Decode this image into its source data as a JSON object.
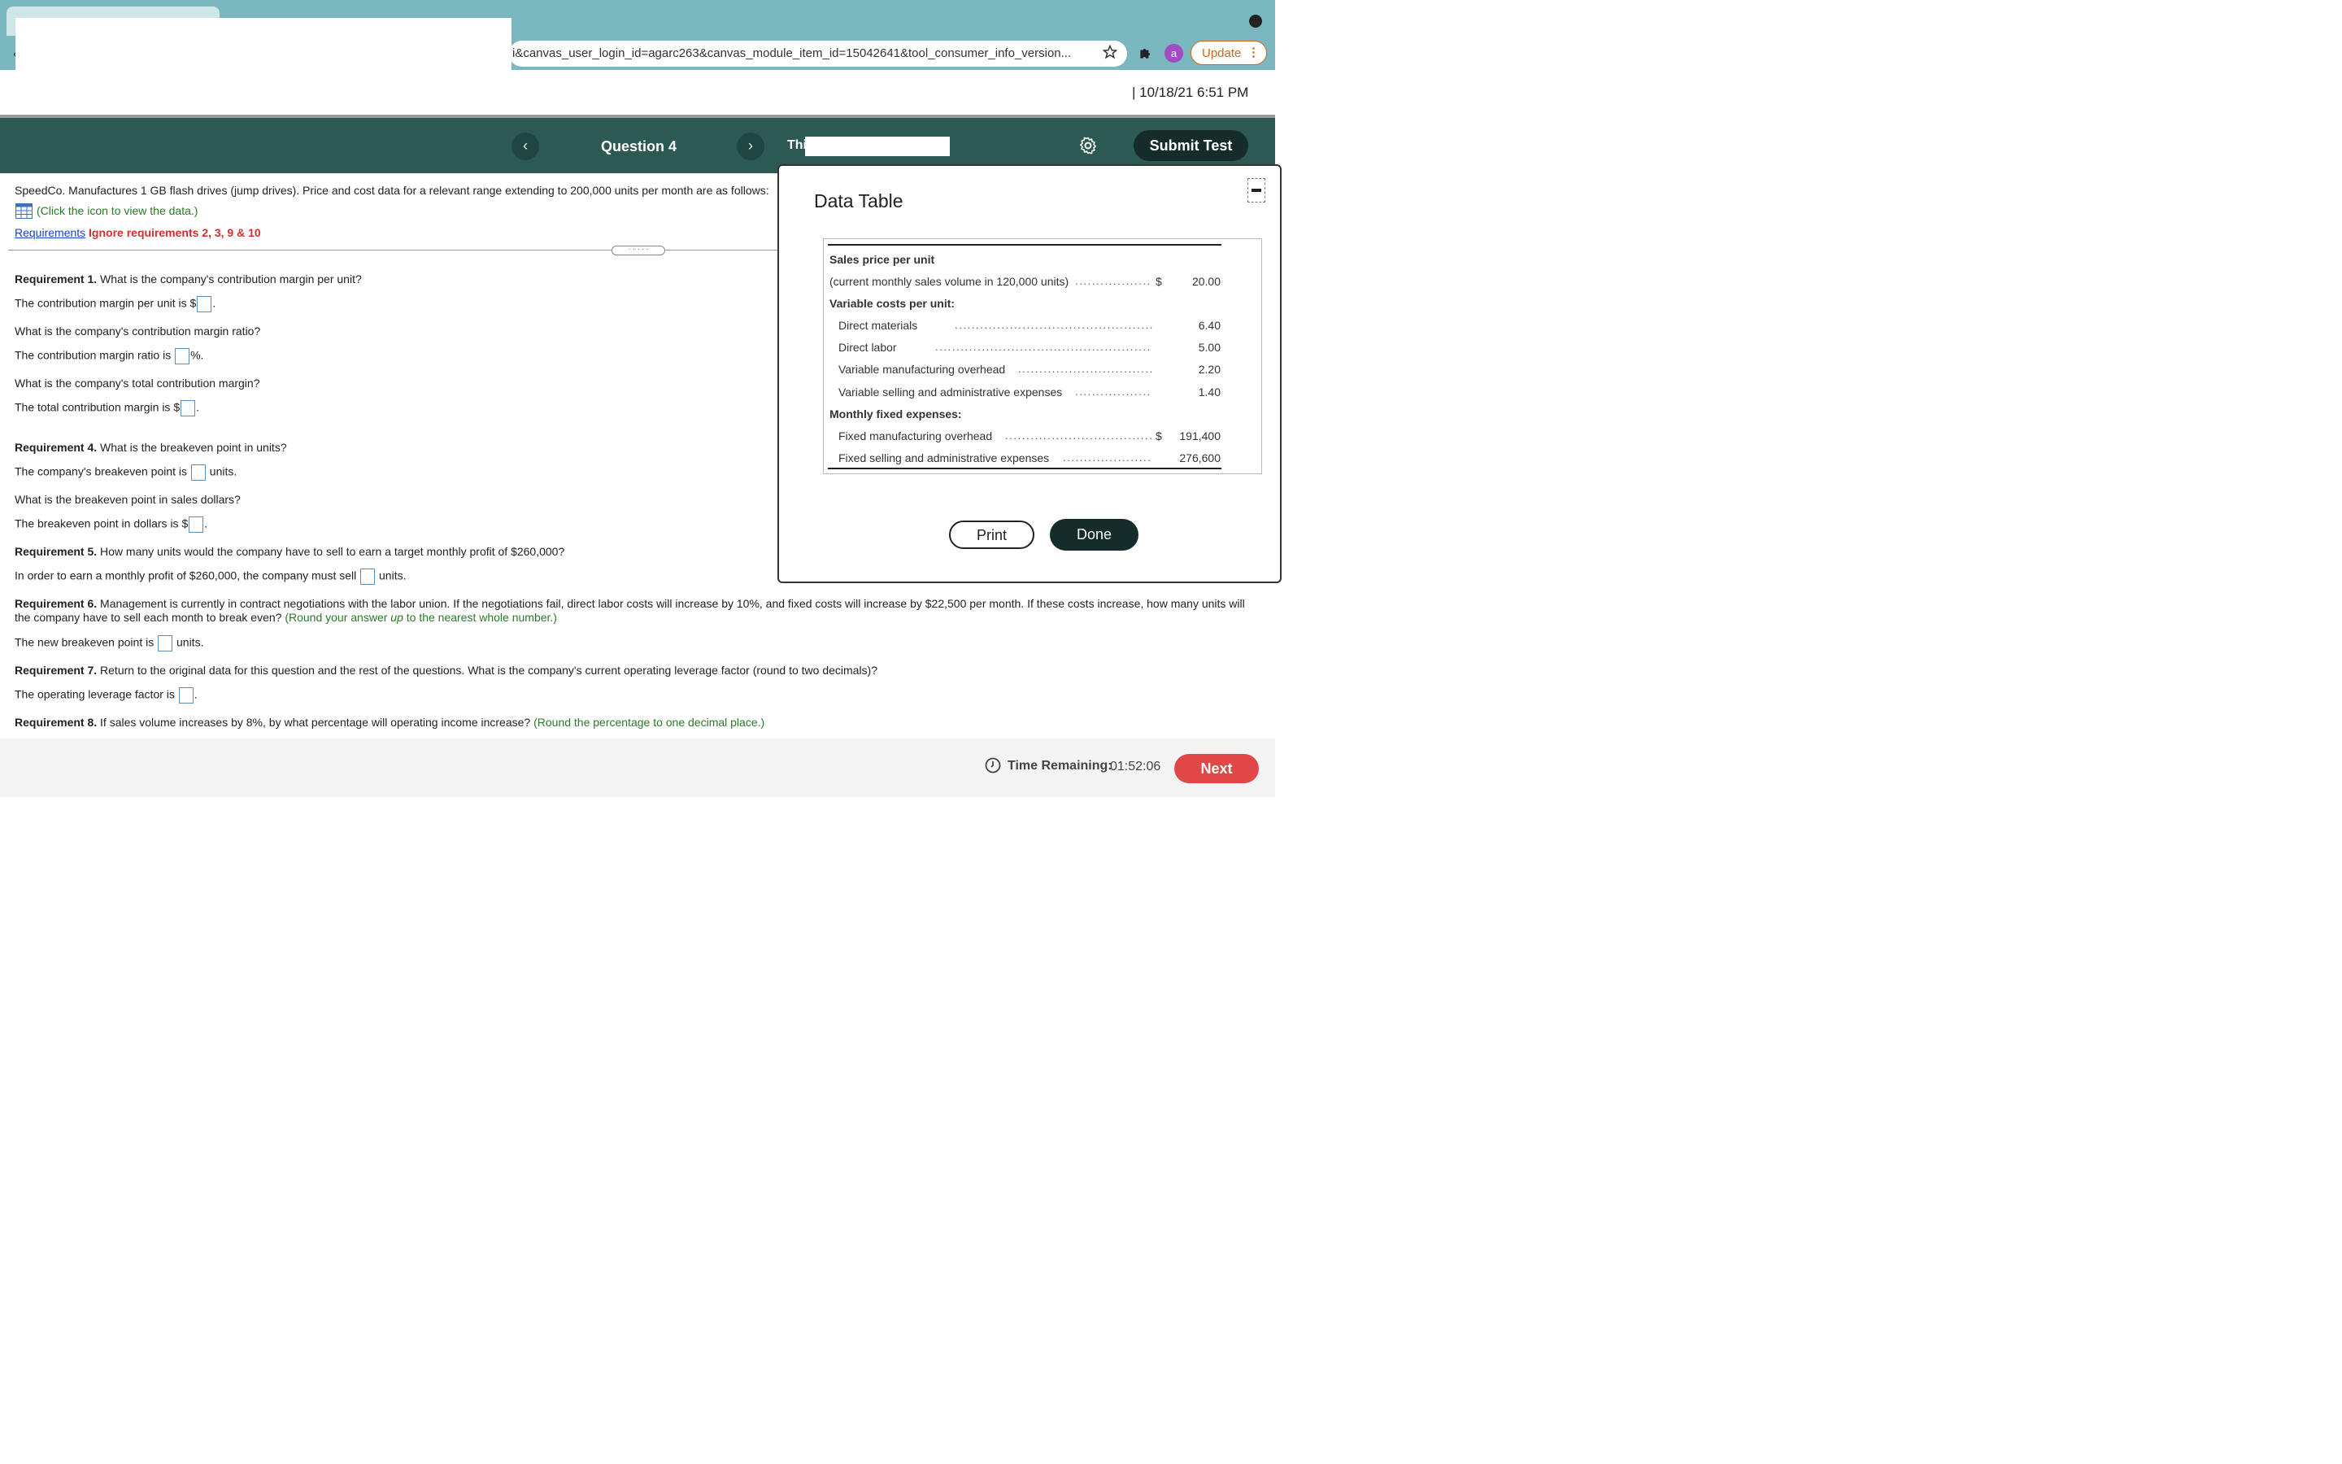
{
  "browser": {
    "url": "i&canvas_user_login_id=agarc263&canvas_module_item_id=15042641&tool_consumer_info_version...",
    "avatar_letter": "a",
    "update_label": "Update",
    "update_menu": "⋮",
    "back": "‹"
  },
  "header": {
    "datetime": "|   10/18/21 6:51 PM"
  },
  "test_bar": {
    "prev": "‹",
    "question_label": "Question 4",
    "next": "›",
    "title_visible": "Thi",
    "submit_label": "Submit Test"
  },
  "question": {
    "intro": "SpeedCo. Manufactures 1 GB flash drives (jump drives). Price and cost data for a relevant range extending to 200,000 units per month are as follows:",
    "view_data": "(Click the icon to view the data.)",
    "requirements_link": "Requirements",
    "ignore_note": "Ignore requirements 2, 3, 9 & 10",
    "divider_handle": "· · · · ·",
    "req1_label": "Requirement 1.",
    "req1_text": " What is the company's contribution margin per unit?",
    "cm_unit_pre": "The contribution margin per unit is $",
    "cm_unit_post": ".",
    "cm_ratio_q": "What is the company's contribution margin ratio?",
    "cm_ratio_pre": "The contribution margin ratio is",
    "cm_ratio_post": "%.",
    "total_cm_q": "What is the company's total contribution margin?",
    "total_cm_pre": "The total contribution margin is $",
    "total_cm_post": ".",
    "req4_label": "Requirement 4.",
    "req4_text": " What is the breakeven point in units?",
    "be_units_pre": "The company's breakeven point is",
    "be_units_post": "units.",
    "be_dollars_q": "What is the breakeven point in sales dollars?",
    "be_dollars_pre": "The breakeven point in dollars is $",
    "be_dollars_post": ".",
    "req5_label": "Requirement 5.",
    "req5_text": " How many units would the company have to sell to earn a target monthly profit of $260,000?",
    "target_pre": "In order to earn a monthly profit of $260,000, the company must sell",
    "target_post": "units.",
    "req6_label": "Requirement 6.",
    "req6_text_1": " Management is currently in contract negotiations with the labor union. If the negotiations fail, direct labor costs will increase by 10%, and fixed costs will increase by $22,500 per month. If these costs increase, how many units will",
    "req6_text_2": "the company have to sell each month to break even?",
    "req6_hint_pre": " (Round your answer ",
    "req6_hint_em": "up",
    "req6_hint_post": " to the nearest whole number.)",
    "new_be_pre": "The new breakeven point is",
    "new_be_post": "units.",
    "req7_label": "Requirement 7.",
    "req7_text": " Return to the original data for this question and the rest of the questions. What is the company's current operating leverage factor (round to two decimals)?",
    "olf_pre": "The operating leverage factor is",
    "olf_post": ".",
    "req8_label": "Requirement 8.",
    "req8_text": " If sales volume increases by 8%, by what percentage will operating income increase?",
    "req8_hint": " (Round the percentage to one decimal place.)"
  },
  "data_table": {
    "title": "Data Table",
    "rows": [
      {
        "label": "Sales price per unit"
      },
      {
        "label": "(current monthly sales volume in 120,000 units)",
        "dollar": "$",
        "value": "20.00"
      },
      {
        "label": "Variable costs per unit:"
      },
      {
        "label": "Direct materials",
        "value": "6.40"
      },
      {
        "label": "Direct labor",
        "value": "5.00"
      },
      {
        "label": "Variable manufacturing overhead",
        "value": "2.20"
      },
      {
        "label": "Variable selling and administrative expenses",
        "value": "1.40"
      },
      {
        "label": "Monthly fixed expenses:"
      },
      {
        "label": "Fixed manufacturing overhead",
        "dollar": "$",
        "value": "191,400"
      },
      {
        "label": "Fixed selling and administrative expenses",
        "value": "276,600"
      }
    ],
    "print_label": "Print",
    "done_label": "Done"
  },
  "footer": {
    "time_label": "Time Remaining:",
    "time_value": "01:52:06",
    "next_label": "Next"
  },
  "colors": {
    "chrome": "#7ab8bf",
    "test_bar": "#2c5a52",
    "submit": "#152c2a",
    "next": "#e04848",
    "hint_green": "#2a7a2a",
    "ignore_red": "#d42f2f"
  }
}
